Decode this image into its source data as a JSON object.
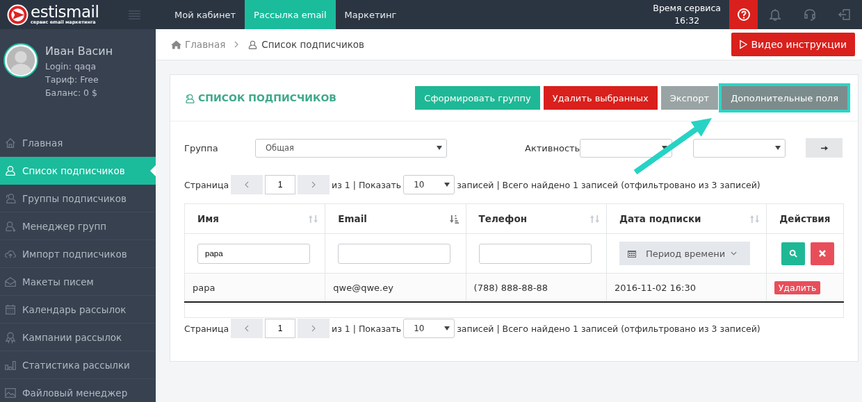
{
  "logo": {
    "name": "estismail",
    "tagline": "сервис email маркетинга"
  },
  "nav": [
    {
      "label": "Мой кабинет",
      "selected": false
    },
    {
      "label": "Рассылка email",
      "selected": true
    },
    {
      "label": "Маркетинг",
      "selected": false
    }
  ],
  "service_time": {
    "label": "Время сервиса",
    "time": "16:32"
  },
  "user": {
    "name": "Иван Васин",
    "login": "Login: qaqa",
    "tariff": "Тариф: Free",
    "balance": "Баланс: 0 $"
  },
  "sidebar": {
    "items": [
      {
        "label": "Главная",
        "selected": false
      },
      {
        "label": "Список подписчиков",
        "selected": true
      },
      {
        "label": "Группы подписчиков",
        "selected": false
      },
      {
        "label": "Менеджер групп",
        "selected": false
      },
      {
        "label": "Импорт подписчиков",
        "selected": false
      },
      {
        "label": "Макеты писем",
        "selected": false
      },
      {
        "label": "Календарь рассылок",
        "selected": false
      },
      {
        "label": "Кампании рассылок",
        "selected": false
      },
      {
        "label": "Статистика рассылки",
        "selected": false
      },
      {
        "label": "Файловый менеджер",
        "selected": false
      }
    ]
  },
  "breadcrumb": [
    {
      "label": "Главная"
    },
    {
      "label": "Список подписчиков"
    }
  ],
  "video_button": "Видео инструкции",
  "card": {
    "title": "СПИСОК ПОДПИСЧИКОВ",
    "buttons": [
      {
        "label": "Сформировать группу",
        "kind": "success",
        "highlighted": false
      },
      {
        "label": "Удалить выбранных",
        "kind": "danger",
        "highlighted": false
      },
      {
        "label": "Экспорт",
        "kind": "neutral",
        "highlighted": false
      },
      {
        "label": "Дополнительные поля",
        "kind": "dark",
        "highlighted": true
      }
    ],
    "filters": {
      "group_label": "Группа",
      "group_value": "Общая",
      "activity_label": "Активность"
    },
    "pager_top": {
      "label": "Страница",
      "page": "1",
      "of": "из 1 | Показать",
      "per_page": "10",
      "summary": "записей | Всего найдено 1 записей (отфильтровано из 3 записей)"
    },
    "table": {
      "columns": [
        {
          "label": "Имя",
          "sorted": false
        },
        {
          "label": "Email",
          "sorted": true
        },
        {
          "label": "Телефон",
          "sorted": false
        },
        {
          "label": "Дата подписки",
          "sorted": false
        },
        {
          "label": "Действия"
        }
      ],
      "filter_row": {
        "name": "papa",
        "period": "Период времени"
      },
      "rows": [
        {
          "name": "papa",
          "email": "qwe@qwe.ey",
          "phone": "(788) 888-88-88",
          "date": "2016-11-02 16:30",
          "action": "Удалить"
        }
      ]
    },
    "pager_bottom": {
      "label": "Страница",
      "page": "1",
      "of": "из 1 | Показать",
      "per_page": "10",
      "summary": "записей | Всего найдено 1 записей (отфильтровано из 3 записей)"
    }
  }
}
